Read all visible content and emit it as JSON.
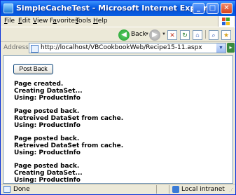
{
  "window": {
    "title": "SimpleCacheTest - Microsoft Internet Explorer",
    "controls": {
      "minimize": "_",
      "maximize": "□",
      "close": "✕"
    }
  },
  "menu": {
    "items": [
      {
        "u": "F",
        "rest": "ile"
      },
      {
        "u": "E",
        "rest": "dit"
      },
      {
        "u": "V",
        "rest": "iew"
      },
      {
        "pre": "F",
        "u": "a",
        "rest": "vorites"
      },
      {
        "u": "T",
        "rest": "ools"
      },
      {
        "u": "H",
        "rest": "elp"
      }
    ]
  },
  "toolbar": {
    "back_label": "Back",
    "back_icon": "back-arrow-icon",
    "forward_icon": "forward-arrow-icon"
  },
  "address": {
    "label": "Address",
    "url": "http://localhost/VBCookbookWeb/Recipe15-11.aspx"
  },
  "page": {
    "button_label": "Post Back",
    "log": [
      [
        "Page created.",
        "Creating DataSet...",
        "Using: ProductInfo"
      ],
      [
        "Page posted back.",
        "Retreived DataSet from cache.",
        "Using: ProductInfo"
      ],
      [
        "Page posted back.",
        "Retreived DataSet from cache.",
        "Using: ProductInfo"
      ],
      [
        "Page posted back.",
        "Creating DataSet...",
        "Using: ProductInfo"
      ]
    ]
  },
  "status": {
    "text": "Done",
    "zone": "Local intranet"
  },
  "colors": {
    "titlebar": "#0554d8",
    "back_button": "#1e9e2d"
  }
}
